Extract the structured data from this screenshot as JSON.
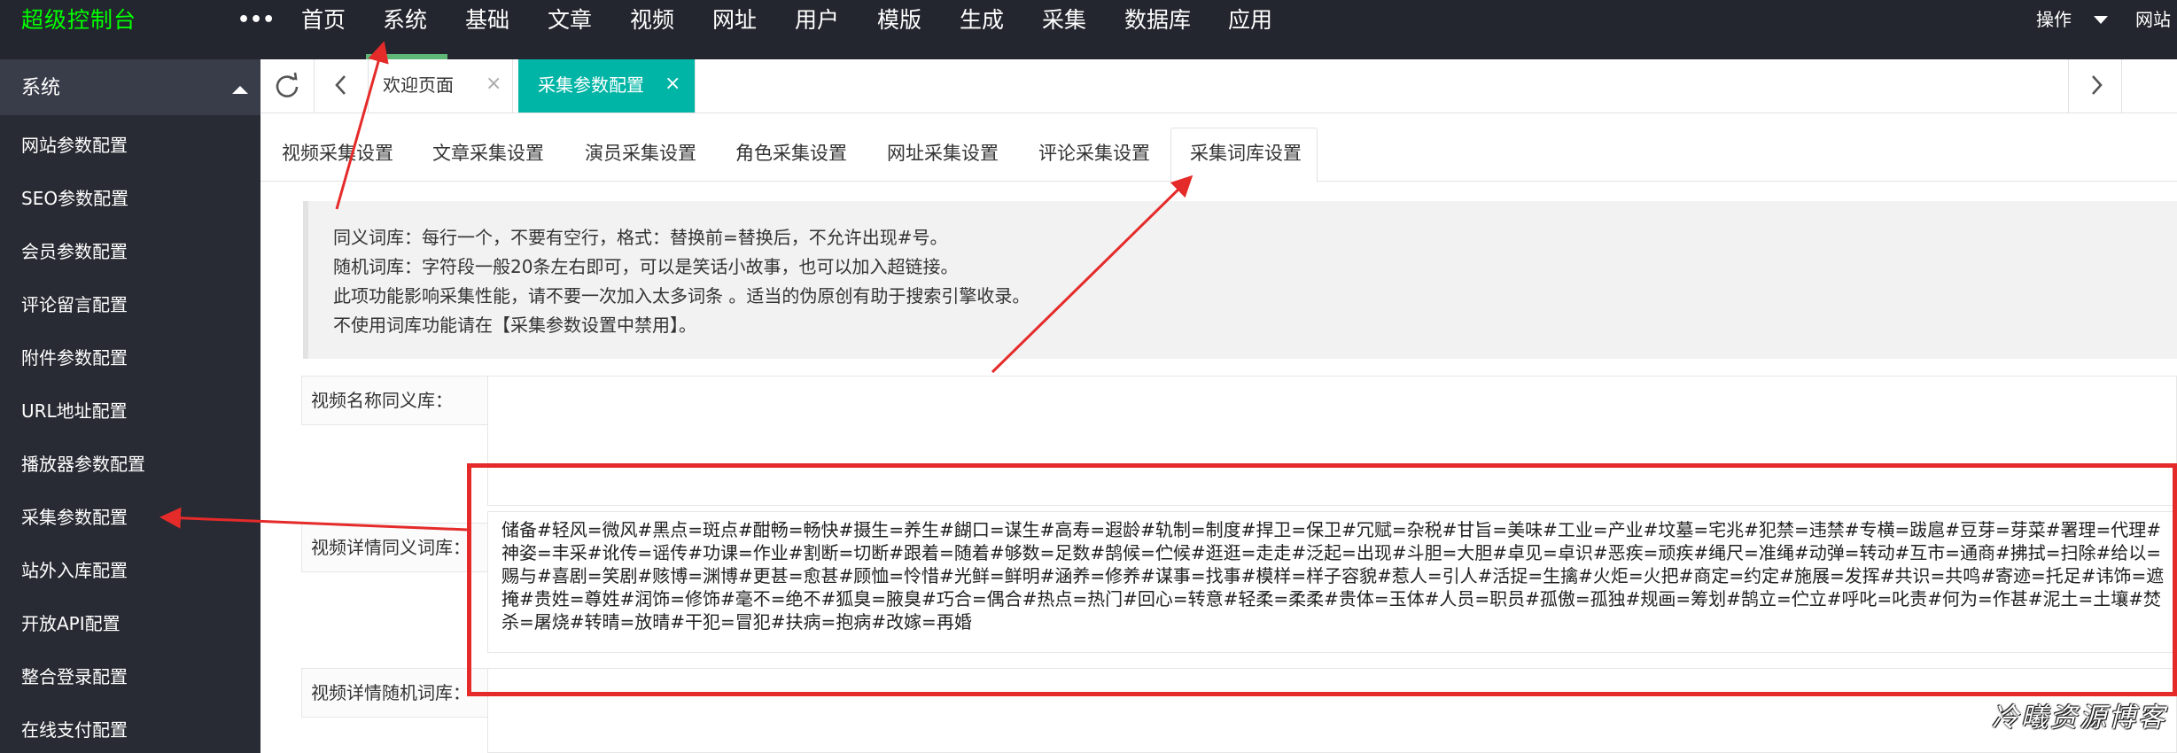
{
  "app": {
    "logo": "超级控制台",
    "more": "•••",
    "nav": [
      "首页",
      "系统",
      "基础",
      "文章",
      "视频",
      "网址",
      "用户",
      "模版",
      "生成",
      "采集",
      "数据库",
      "应用"
    ],
    "active_nav": "系统",
    "operate_label": "操作",
    "site_label": "网站"
  },
  "sidebar": {
    "header": "系统",
    "items": [
      "网站参数配置",
      "SEO参数配置",
      "会员参数配置",
      "评论留言配置",
      "附件参数配置",
      "URL地址配置",
      "播放器参数配置",
      "采集参数配置",
      "站外入库配置",
      "开放API配置",
      "整合登录配置",
      "在线支付配置"
    ]
  },
  "tabs": {
    "items": [
      {
        "label": "欢迎页面",
        "close": "×"
      },
      {
        "label": "采集参数配置",
        "close": "×"
      }
    ],
    "active_tab": "采集参数配置"
  },
  "subtabs": {
    "items": [
      "视频采集设置",
      "文章采集设置",
      "演员采集设置",
      "角色采集设置",
      "网址采集设置",
      "评论采集设置",
      "采集词库设置"
    ],
    "active": "采集词库设置"
  },
  "notice": {
    "lines": [
      "同义词库：每行一个，不要有空行，格式：替换前=替换后，不允许出现#号。",
      "随机词库：字符段一般20条左右即可，可以是笑话小故事，也可以加入超链接。",
      "此项功能影响采集性能，请不要一次加入太多词条 。适当的伪原创有助于搜索引擎收录。",
      "不使用词库功能请在【采集参数设置中禁用】。"
    ]
  },
  "form": {
    "name_synonym_label": "视频名称同义库：",
    "detail_synonym_label": "视频详情同义词库：",
    "detail_synonym_value": "储备#轻风=微风#黑点=斑点#酣畅=畅快#摄生=养生#餬口=谋生#高寿=遐龄#轨制=制度#捍卫=保卫#冗赋=杂税#甘旨=美味#工业=产业#坟墓=宅兆#犯禁=违禁#专横=跋扈#豆芽=芽菜#署理=代理#神姿=丰采#讹传=谣传#功课=作业#割断=切断#跟着=随着#够数=足数#鹄候=伫候#逛逛=走走#泛起=出现#斗胆=大胆#卓见=卓识#恶疾=顽疾#绳尺=准绳#动弹=转动#互市=通商#拂拭=扫除#给以=赐与#喜剧=笑剧#赅博=渊博#更甚=愈甚#顾恤=怜惜#光鲜=鲜明#涵养=修养#谋事=找事#模样=样子容貌#惹人=引人#活捉=生擒#火炬=火把#商定=约定#施展=发挥#共识=共鸣#寄迹=托足#讳饰=遮掩#贵姓=尊姓#润饰=修饰#毫不=绝不#狐臭=腋臭#巧合=偶合#热点=热门#回心=转意#轻柔=柔柔#贵体=玉体#人员=职员#孤傲=孤独#规画=筹划#鹄立=伫立#呼叱=叱责#何为=作甚#泥土=土壤#焚杀=屠烧#转晴=放晴#干犯=冒犯#扶病=抱病#改嫁=再婚",
    "detail_random_label": "视频详情随机词库："
  },
  "watermark": "冷曦资源博客",
  "colors": {
    "topbar": "#23262e",
    "sidebar": "#282b33",
    "logo": "#00ff00",
    "nav_underline": "#5fb878",
    "active_tab": "#00b5a5",
    "annotation_red": "#e52a2a"
  }
}
